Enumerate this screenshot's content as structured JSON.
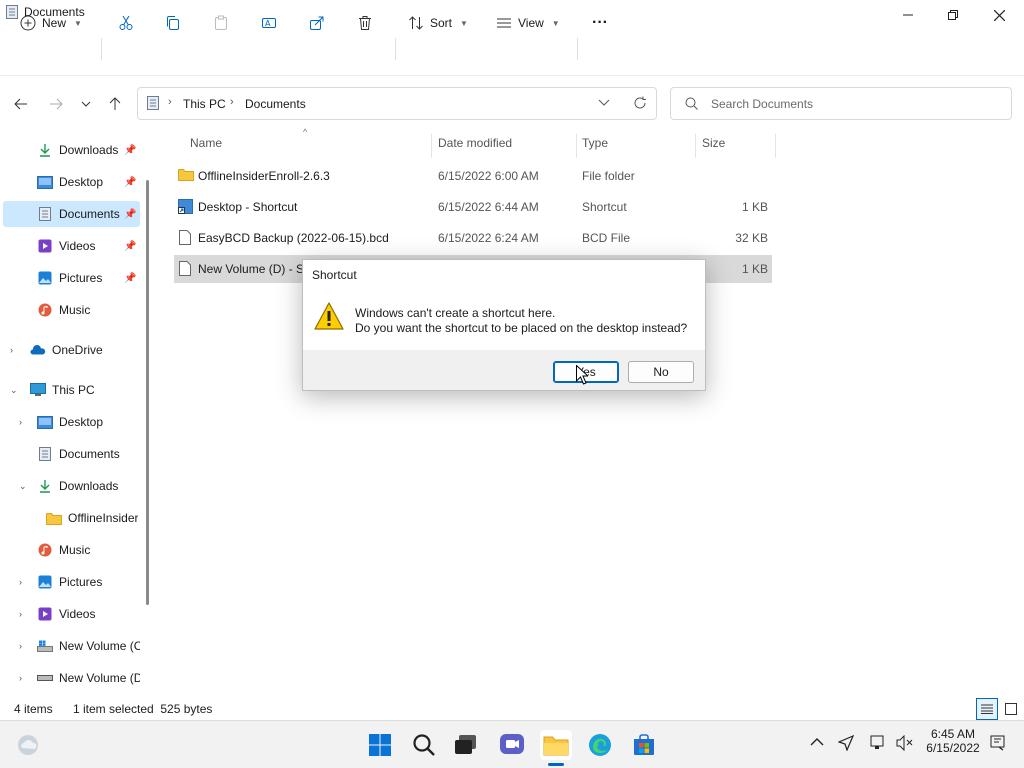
{
  "window": {
    "title": "Documents"
  },
  "toolbar": {
    "new_label": "New",
    "sort_label": "Sort",
    "view_label": "View",
    "more_label": "···"
  },
  "address": {
    "crumbs": [
      "This PC",
      "Documents"
    ],
    "search_placeholder": "Search Documents"
  },
  "sidebar": {
    "quick": [
      {
        "label": "Downloads",
        "icon": "download-icon"
      },
      {
        "label": "Desktop",
        "icon": "desktop-icon"
      },
      {
        "label": "Documents",
        "icon": "documents-icon"
      },
      {
        "label": "Videos",
        "icon": "videos-icon"
      },
      {
        "label": "Pictures",
        "icon": "pictures-icon"
      },
      {
        "label": "Music",
        "icon": "music-icon"
      }
    ],
    "onedrive": "OneDrive",
    "thispc": "This PC",
    "pc_items": [
      {
        "label": "Desktop",
        "icon": "desktop-icon"
      },
      {
        "label": "Documents",
        "icon": "documents-icon"
      },
      {
        "label": "Downloads",
        "icon": "download-icon"
      },
      {
        "label": "OfflineInsider",
        "icon": "folder-icon"
      },
      {
        "label": "Music",
        "icon": "music-icon"
      },
      {
        "label": "Pictures",
        "icon": "pictures-icon"
      },
      {
        "label": "Videos",
        "icon": "videos-icon"
      },
      {
        "label": "New Volume (C",
        "icon": "drive-icon"
      },
      {
        "label": "New Volume (D",
        "icon": "drive-icon"
      }
    ]
  },
  "list": {
    "columns": [
      "Name",
      "Date modified",
      "Type",
      "Size"
    ],
    "rows": [
      {
        "name": "OfflineInsiderEnroll-2.6.3",
        "date": "6/15/2022 6:00 AM",
        "type": "File folder",
        "size": ""
      },
      {
        "name": "Desktop - Shortcut",
        "date": "6/15/2022 6:44 AM",
        "type": "Shortcut",
        "size": "1 KB"
      },
      {
        "name": "EasyBCD Backup (2022-06-15).bcd",
        "date": "6/15/2022 6:24 AM",
        "type": "BCD File",
        "size": "32 KB"
      },
      {
        "name": "New Volume (D) - Sl",
        "date": "",
        "type": "",
        "size": "1 KB"
      }
    ]
  },
  "dialog": {
    "title": "Shortcut",
    "line1": "Windows can't create a shortcut here.",
    "line2": "Do you want the shortcut to be placed on the desktop instead?",
    "yes": "Yes",
    "no": "No"
  },
  "status": {
    "count": "4 items",
    "selected": "1 item selected  525 bytes"
  },
  "clock": {
    "time": "6:45 AM",
    "date": "6/15/2022"
  },
  "colors": {
    "accent": "#0067c0",
    "selection": "#cce8ff",
    "folder": "#f8c73f"
  }
}
